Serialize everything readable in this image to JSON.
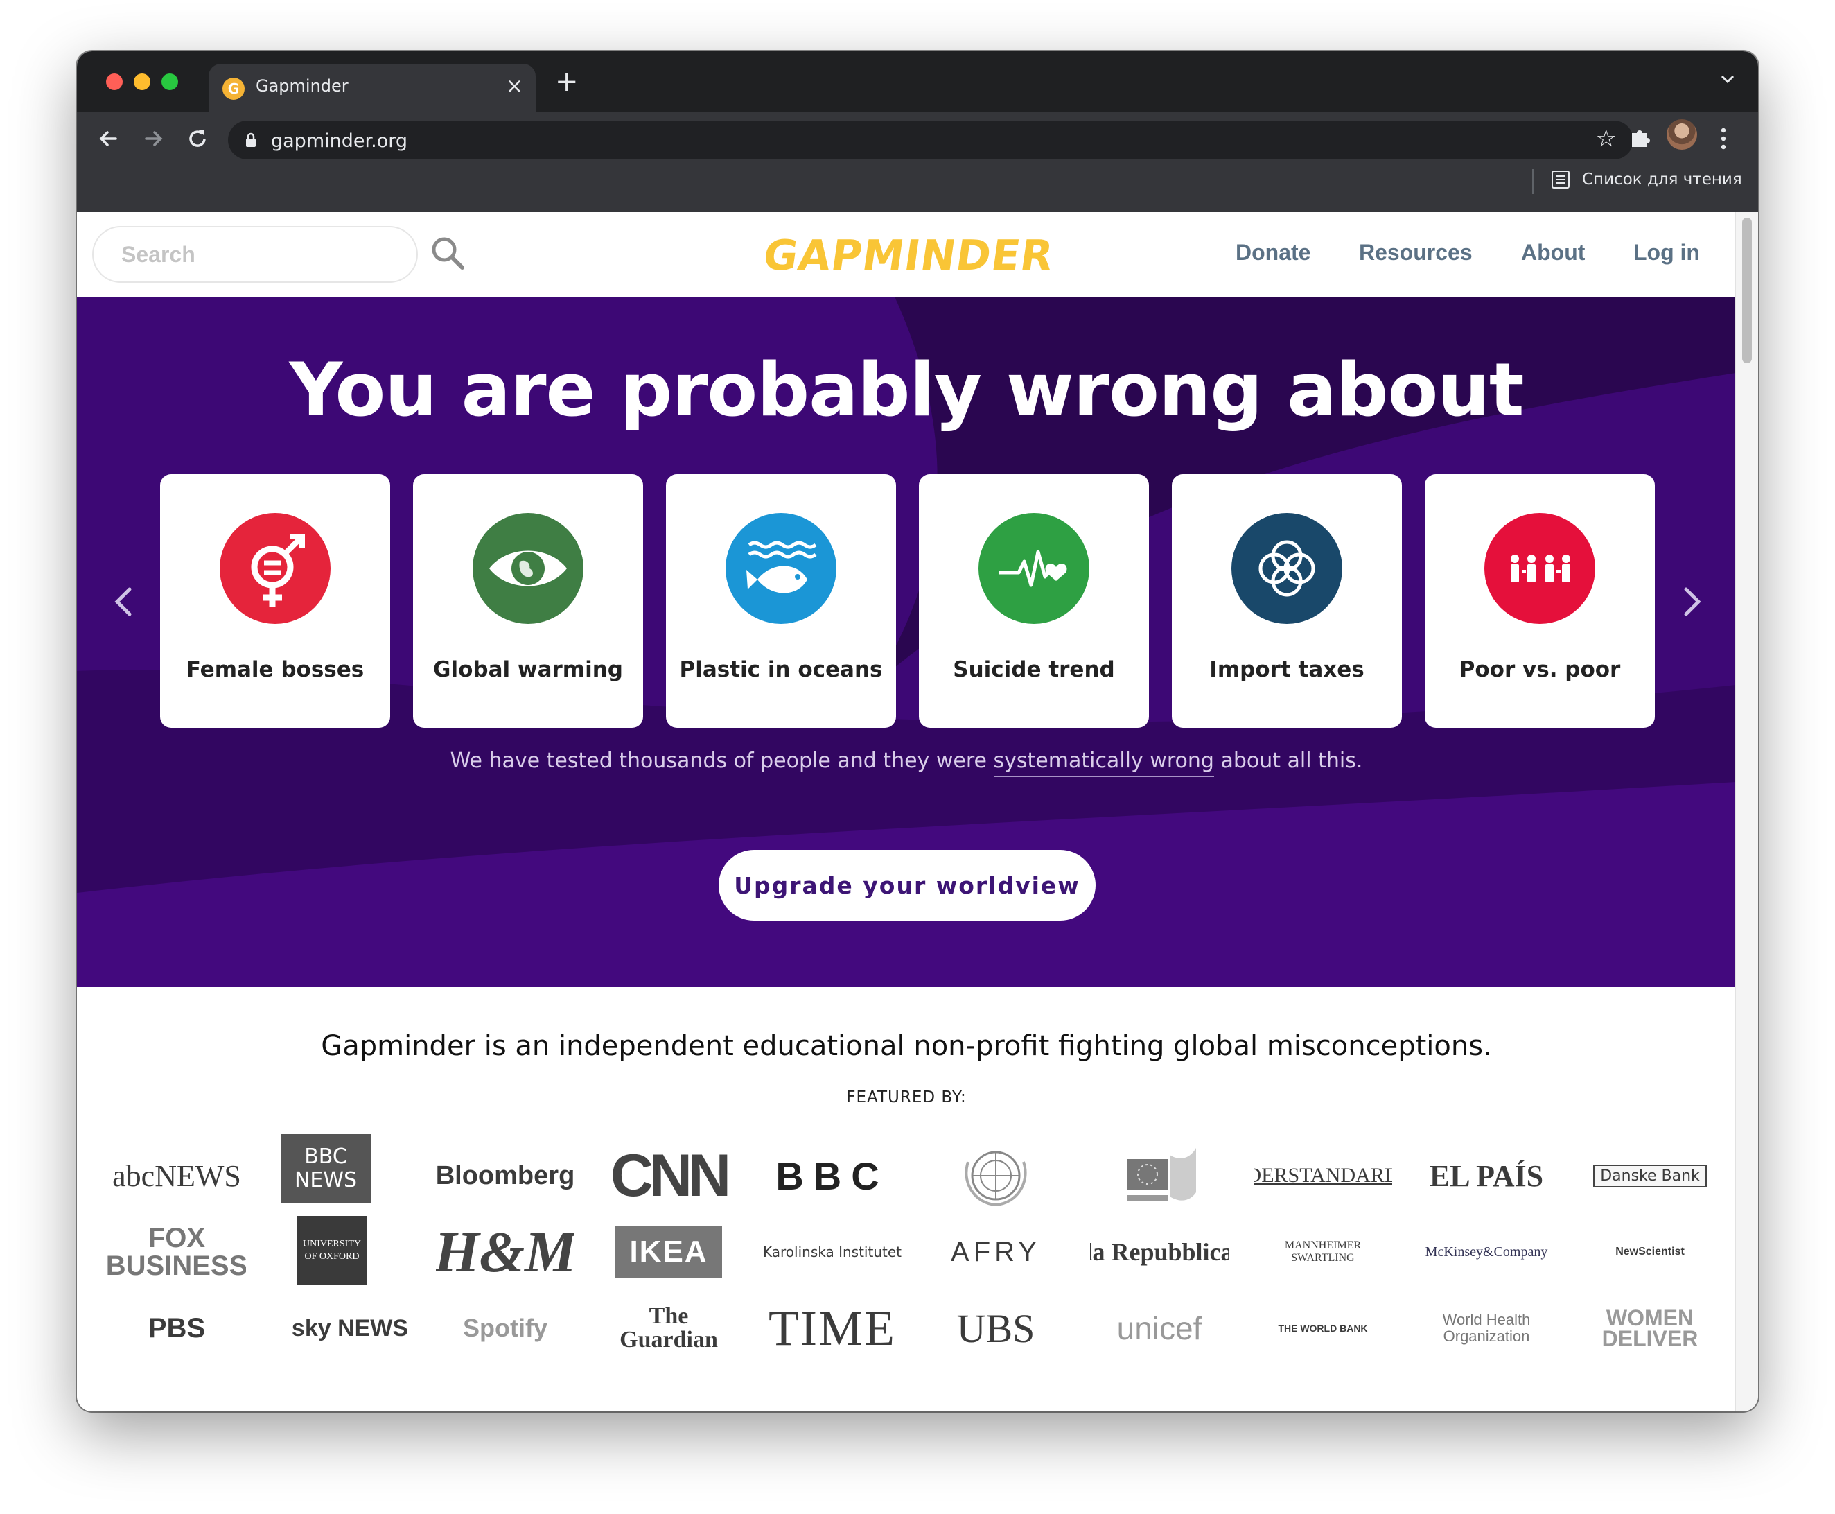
{
  "browser": {
    "tab_title": "Gapminder",
    "tab_favicon": "G",
    "url": "gapminder.org",
    "reading_list_label": "Список для чтения",
    "icons": [
      "back-arrow-icon",
      "forward-arrow-icon",
      "reload-icon",
      "lock-icon",
      "star-icon",
      "puzzle-icon",
      "kebab-menu-icon",
      "close-icon",
      "plus-icon",
      "chevron-down-icon",
      "reading-list-icon"
    ]
  },
  "header": {
    "search_placeholder": "Search",
    "logo_text": "GAPMINDER",
    "nav": [
      "Donate",
      "Resources",
      "About",
      "Log in"
    ]
  },
  "hero": {
    "title": "You are probably wrong about",
    "cards": [
      {
        "label": "Female bosses",
        "color": "#e5243b",
        "icon": "gender-equality-icon"
      },
      {
        "label": "Global warming",
        "color": "#3f7e44",
        "icon": "eye-globe-icon"
      },
      {
        "label": "Plastic in oceans",
        "color": "#0a97d9",
        "icon": "fish-waves-icon"
      },
      {
        "label": "Suicide trend",
        "color": "#4c9f38",
        "icon": "heartbeat-icon"
      },
      {
        "label": "Import taxes",
        "color": "#19486a",
        "icon": "partnership-rings-icon"
      },
      {
        "label": "Poor vs. poor",
        "color": "#e5243b",
        "icon": "people-equality-icon"
      }
    ],
    "subtitle_before": "We have tested thousands of people and they were ",
    "subtitle_link": "systematically wrong",
    "subtitle_after": " about all this.",
    "cta": "Upgrade your worldview",
    "colors": {
      "background": "#3d0875",
      "dark": "#2a0650",
      "accent": "#4a0b8a"
    }
  },
  "about": {
    "tagline": "Gapminder is an independent educational non-profit fighting global misconceptions.",
    "featured_label": "FEATURED BY:"
  },
  "press_logos": [
    "abcNEWS",
    "BBC NEWS",
    "Bloomberg",
    "CNN",
    "BBC",
    "United Nations",
    "European Commission",
    "DERSTANDARD",
    "EL PAÍS",
    "Danske Bank",
    "FOX BUSINESS",
    "UNIVERSITY OF OXFORD",
    "H&M",
    "IKEA",
    "Karolinska Institutet",
    "AFRY",
    "la Repubblica",
    "MANNHEIMER SWARTLING",
    "McKinsey&Company",
    "NewScientist",
    "PBS",
    "sky NEWS",
    "Spotify",
    "The Guardian",
    "TIME",
    "UBS",
    "unicef",
    "THE WORLD BANK",
    "World Health Organization",
    "WOMEN DELIVER"
  ]
}
